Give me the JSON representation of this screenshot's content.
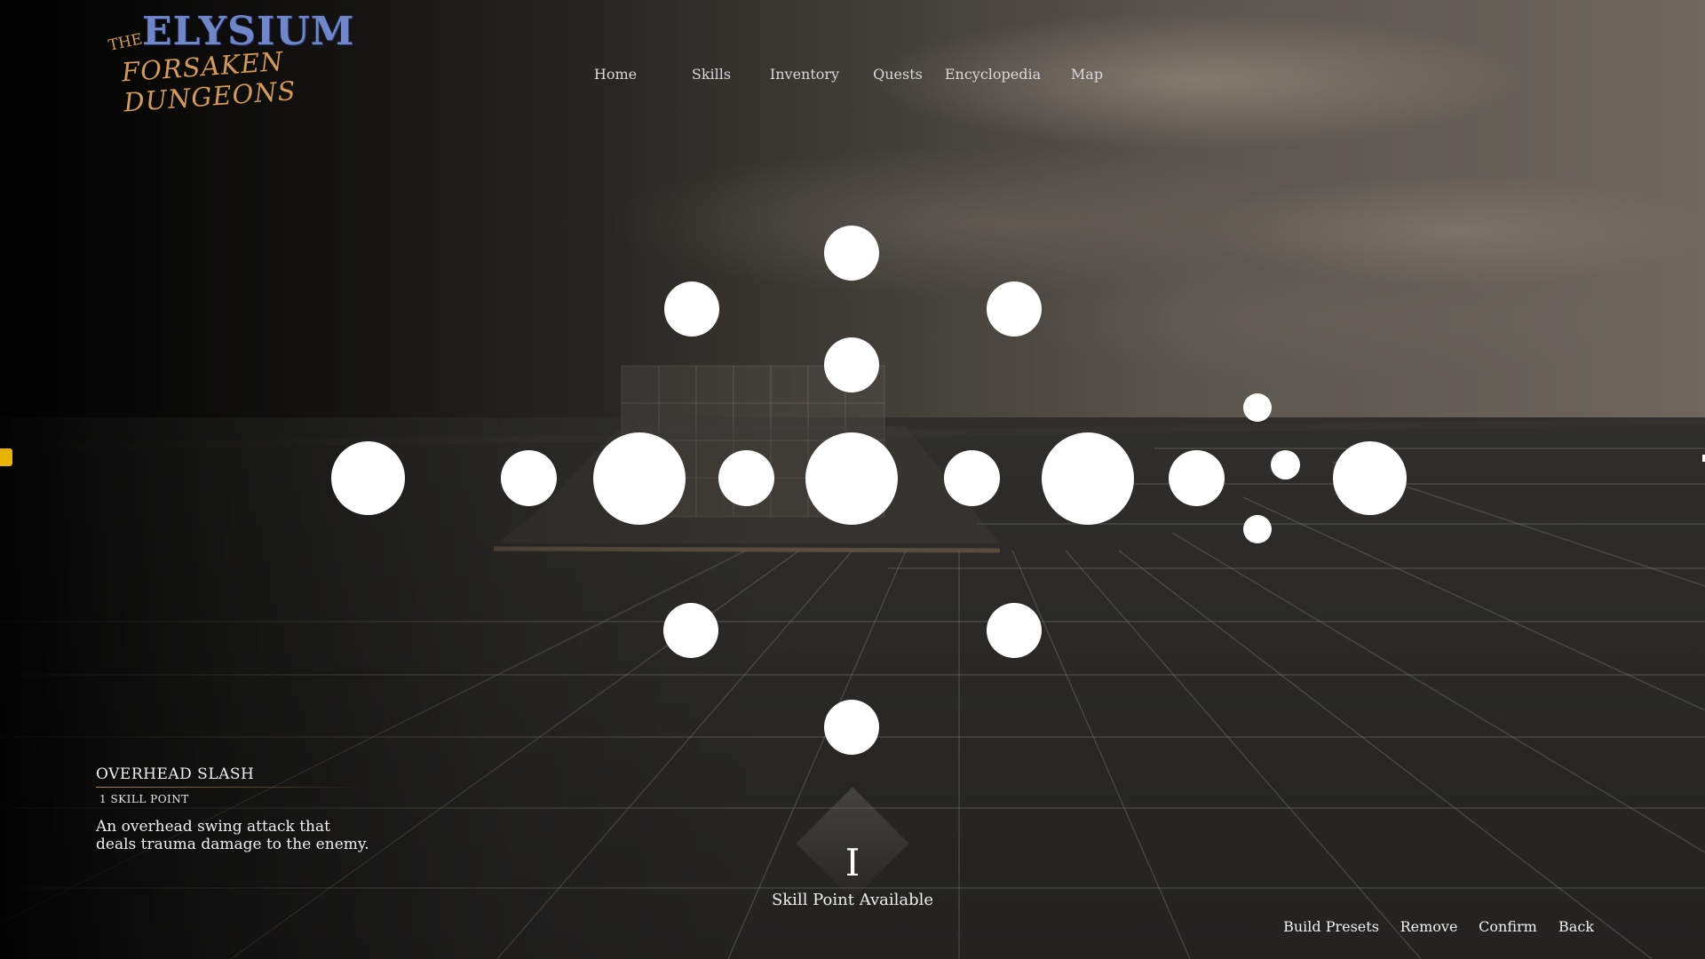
{
  "logo": {
    "the": "THE",
    "title": "ELYSIUM",
    "subtitle": "FORSAKEN DUNGEONS"
  },
  "nav": {
    "items": [
      "Home",
      "Skills",
      "Inventory",
      "Quests",
      "Encyclopedia",
      "Map"
    ]
  },
  "skill": {
    "name": "OVERHEAD SLASH",
    "cost": "1 SKILL POINT",
    "description": "An overhead swing attack that deals trauma damage to the enemy."
  },
  "skill_points": {
    "count": "I",
    "label": "Skill Point Available"
  },
  "actions": {
    "build_presets": "Build Presets",
    "remove": "Remove",
    "confirm": "Confirm",
    "back": "Back"
  },
  "colors": {
    "node": "#ffffff",
    "accent_gold": "#d39a58",
    "logo_blue": "#6f86c8",
    "marker_yellow": "#e8b400"
  }
}
